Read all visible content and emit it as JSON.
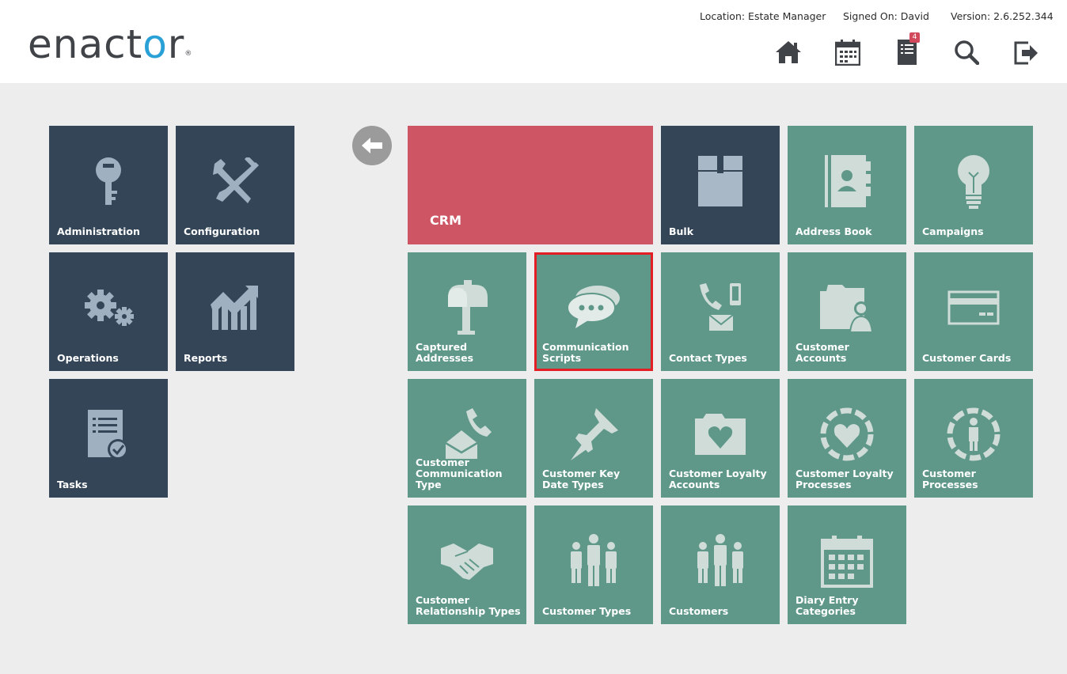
{
  "header": {
    "logo_text": "enactor",
    "location": "Location: Estate Manager",
    "signed_on": "Signed On: David",
    "version": "Version: 2.6.252.344",
    "icons": [
      "home-icon",
      "calendar-icon",
      "task-list-icon",
      "search-icon",
      "logout-icon"
    ],
    "task_badge": "4"
  },
  "left_menu": [
    {
      "label": "Administration",
      "icon": "key-icon"
    },
    {
      "label": "Configuration",
      "icon": "tools-icon"
    },
    {
      "label": "Operations",
      "icon": "gears-icon"
    },
    {
      "label": "Reports",
      "icon": "chart-icon"
    },
    {
      "label": "Tasks",
      "icon": "checklist-icon"
    }
  ],
  "crm": {
    "title": "CRM",
    "accent": "#ce5664",
    "tiles": [
      {
        "label": "Bulk",
        "icon": "box-icon",
        "style": "dark"
      },
      {
        "label": "Address Book",
        "icon": "address-book-icon"
      },
      {
        "label": "Campaigns",
        "icon": "lightbulb-icon"
      },
      {
        "label": "Captured Addresses",
        "icon": "mailbox-icon"
      },
      {
        "label": "Communication Scripts",
        "icon": "speech-bubble-icon",
        "selected": true
      },
      {
        "label": "Contact Types",
        "icon": "phone-mail-icon"
      },
      {
        "label": "Customer Accounts",
        "icon": "folder-user-icon"
      },
      {
        "label": "Customer Cards",
        "icon": "card-icon"
      },
      {
        "label": "Customer Communication Type",
        "icon": "phone-envelope-icon"
      },
      {
        "label": "Customer Key Date Types",
        "icon": "pushpin-icon"
      },
      {
        "label": "Customer Loyalty Accounts",
        "icon": "folder-heart-icon"
      },
      {
        "label": "Customer Loyalty Processes",
        "icon": "heart-cycle-icon"
      },
      {
        "label": "Customer Processes",
        "icon": "person-cycle-icon"
      },
      {
        "label": "Customer Relationship Types",
        "icon": "handshake-icon"
      },
      {
        "label": "Customer Types",
        "icon": "people-group-icon"
      },
      {
        "label": "Customers",
        "icon": "people-group-icon"
      },
      {
        "label": "Diary Entry Categories",
        "icon": "calendar-icon"
      }
    ]
  },
  "colors": {
    "dark_tile": "#334557",
    "green_tile": "#5f9889",
    "selected_outline": "#e31e24"
  }
}
